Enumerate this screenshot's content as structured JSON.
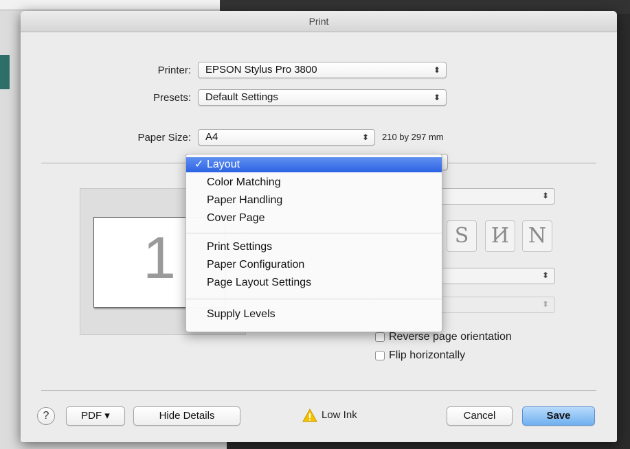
{
  "dialog": {
    "title": "Print"
  },
  "printer": {
    "label": "Printer:",
    "value": "EPSON Stylus Pro 3800"
  },
  "presets": {
    "label": "Presets:",
    "value": "Default Settings"
  },
  "paper_size": {
    "label": "Paper Size:",
    "value": "A4",
    "dimensions": "210 by 297 mm"
  },
  "preview": {
    "page_number": "1"
  },
  "panel_menu": {
    "items": [
      {
        "label": "Layout",
        "selected": true,
        "check": "✓"
      },
      {
        "label": "Color Matching"
      },
      {
        "label": "Paper Handling"
      },
      {
        "label": "Cover Page"
      },
      {
        "label": "Print Settings"
      },
      {
        "label": "Paper Configuration"
      },
      {
        "label": "Page Layout Settings"
      },
      {
        "label": "Supply Levels"
      }
    ]
  },
  "layout_options": {
    "page_direction_glyphs": [
      "S",
      "И",
      "N"
    ],
    "reverse_orientation": {
      "label": "Reverse page orientation",
      "checked": false
    },
    "flip_horizontally": {
      "label": "Flip horizontally",
      "checked": false
    }
  },
  "footer": {
    "help": "?",
    "pdf": "PDF ▾",
    "hide_details": "Hide Details",
    "low_ink": "Low Ink",
    "cancel": "Cancel",
    "save": "Save"
  },
  "colors": {
    "accent": "#2d63e4",
    "warning": "#f2c200"
  },
  "icons": {
    "popup_arrows": "⇕",
    "warning": "warning-triangle-icon"
  }
}
